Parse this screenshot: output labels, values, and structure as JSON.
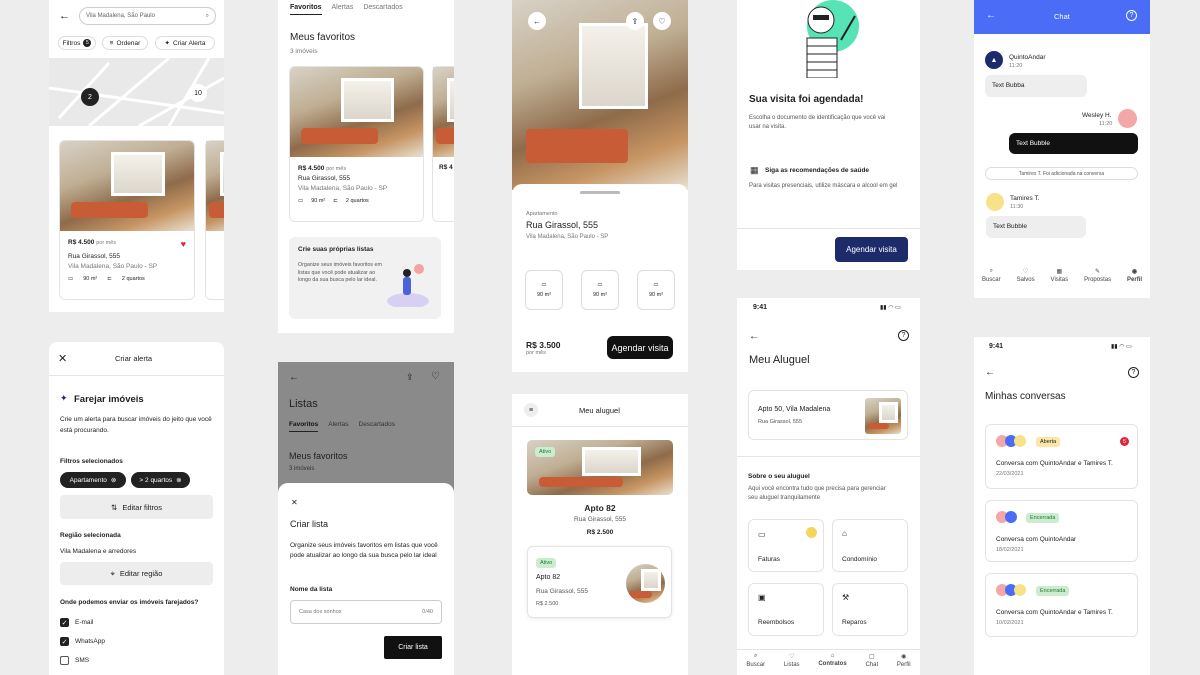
{
  "search": {
    "placeholder": "Vila Madalena, São Paulo",
    "filters": "Filtros",
    "filters_count": "5",
    "order": "Ordenar",
    "alert": "Criar Alerta",
    "map_pin1": "2",
    "map_pin2": "10",
    "card": {
      "price": "R$ 4.500",
      "price_unit": "por mês",
      "street": "Rua Girassol, 555",
      "hood": "Vila Madalena, São Paulo - SP",
      "area": "90 m²",
      "rooms": "2 quartos"
    }
  },
  "fav": {
    "tabs": [
      "Favoritos",
      "Alertas",
      "Descartados"
    ],
    "title": "Meus favoritos",
    "count": "3 imóveis",
    "card": {
      "price": "R$ 4.500",
      "price_unit": "por mês",
      "street": "Rua Girassol, 555",
      "hood": "Vila Madalena, São Paulo - SP",
      "area": "90 m²",
      "rooms": "2 quartos"
    },
    "promo_title": "Crie suas próprias listas",
    "promo_text": "Organize seus imóveis favoritos em listas que você pode atualizar ao longo da sua busca pelo lar ideal.",
    "partial_price": "R$ 4"
  },
  "detail": {
    "type": "Apartamento",
    "street": "Rua Girassol, 555",
    "hood": "Vila Madalena, São Paulo - SP",
    "feat": [
      "90 m²",
      "90 m²",
      "90 m²"
    ],
    "price": "R$ 3.500",
    "price_unit": "por mês",
    "cta": "Agendar visita"
  },
  "visit": {
    "title": "Sua visita foi agendada!",
    "text": "Escolha o documento de identificação que você vai usar na visita.",
    "health_title": "Siga as recomendações de saúde",
    "health_text": "Para visitas presenciais, utilize máscara e alcool em gel",
    "cta": "Agendar visita"
  },
  "chat": {
    "title": "Chat",
    "m1_name": "QuintoAndar",
    "m1_time": "11:20",
    "m1_text": "Text Bubba",
    "m2_name": "Wesley H.",
    "m2_time": "11:20",
    "m2_text": "Text Bubble",
    "sys": "Tamires T. Foi adicionada na conversa",
    "m3_name": "Tamires T.",
    "m3_time": "11:30",
    "m3_text": "Text Bubble",
    "nav": [
      "Buscar",
      "Salvos",
      "Visitas",
      "Propostas",
      "Perfil"
    ]
  },
  "alert": {
    "header": "Criar alerta",
    "title": "Farejar imóveis",
    "desc": "Crie um alerta para buscar imóveis do jeito que você está procurando.",
    "filters_label": "Filtros selecionados",
    "chip1": "Apartamento",
    "chip2": "> 2 quartos",
    "edit_filters": "Editar filtros",
    "region_label": "Região selecionada",
    "region": "Vila Madalena e arredores",
    "edit_region": "Editar região",
    "send_label": "Onde podemos enviar os imóveis farejados?",
    "opts": [
      "E-mail",
      "WhatsApp",
      "SMS"
    ]
  },
  "lists": {
    "title": "Listas",
    "tabs": [
      "Favoritos",
      "Alertas",
      "Descartados"
    ],
    "sub": "Meus favoritos",
    "count": "3 imóveis",
    "sheet_title": "Criar lista",
    "sheet_text": "Organize seus imóveis favoritos em listas que você pode atualizar ao longo da sua busca pelo lar ideal",
    "name_label": "Nome da lista",
    "name_placeholder": "Casa dos sonhos",
    "counter": "0/40",
    "cta": "Criar lista"
  },
  "rent": {
    "header": "Meu aluguel",
    "badge": "Ativo",
    "apt": "Apto 82",
    "street": "Rua Girassol, 555",
    "price": "R$ 2.500",
    "badge2": "Ativo",
    "apt2": "Apto 82",
    "street2": "Rua Girassol, 555",
    "price2": "R$ 2.500"
  },
  "my_rent": {
    "time": "9:41",
    "title": "Meu Aluguel",
    "apt": "Apto 50, Vila Madalena",
    "street": "Rua Girassol, 555",
    "about": "Sobre o seu aluguel",
    "about_text": "Aqui você encontra tudo que precisa para gerenciar seu aluguel tranquilamente",
    "tiles": [
      "Faturas",
      "Condomínio",
      "Reembolsos",
      "Reparos"
    ],
    "nav": [
      "Buscar",
      "Listas",
      "Contratos",
      "Chat",
      "Perfil"
    ]
  },
  "convs": {
    "time": "9:41",
    "title": "Minhas conversas",
    "items": [
      {
        "status": "Aberta",
        "text": "Conversa com QuintoAndar e Tamires T.",
        "date": "22/03/2021",
        "unread": "5"
      },
      {
        "status": "Encerrada",
        "text": "Conversa com QuintoAndar",
        "date": "18/02/2021"
      },
      {
        "status": "Encerrada",
        "text": "Conversa com QuintoAndar e Tamires T.",
        "date": "10/02/2021"
      }
    ]
  },
  "colors": {
    "navy": "#1d2b6b",
    "chat_blue": "#4a6cf7",
    "green_badge": "#cdeccf",
    "yellow_badge": "#fbe6a6"
  }
}
